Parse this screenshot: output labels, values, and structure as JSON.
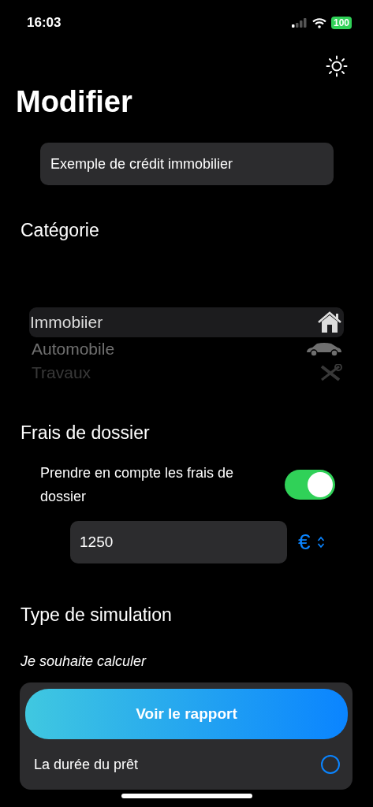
{
  "status_bar": {
    "time": "16:03",
    "battery": "100"
  },
  "title": "Modifier",
  "name_field": {
    "value": "Exemple de crédit immobilier"
  },
  "category": {
    "heading": "Catégorie",
    "items": [
      {
        "label": "Immobiier",
        "selected": true
      },
      {
        "label": "Automobile",
        "selected": false
      },
      {
        "label": "Travaux",
        "selected": false
      }
    ]
  },
  "fees": {
    "heading": "Frais de dossier",
    "toggle_label": "Prendre en compte les frais de dossier",
    "on": true,
    "amount": "1250",
    "currency": "€"
  },
  "simulation": {
    "heading": "Type de simulation",
    "subtitle": "Je souhaite calculer",
    "button": "Voir le rapport",
    "options": [
      {
        "label": "La durée du prêt",
        "selected": false
      }
    ]
  }
}
